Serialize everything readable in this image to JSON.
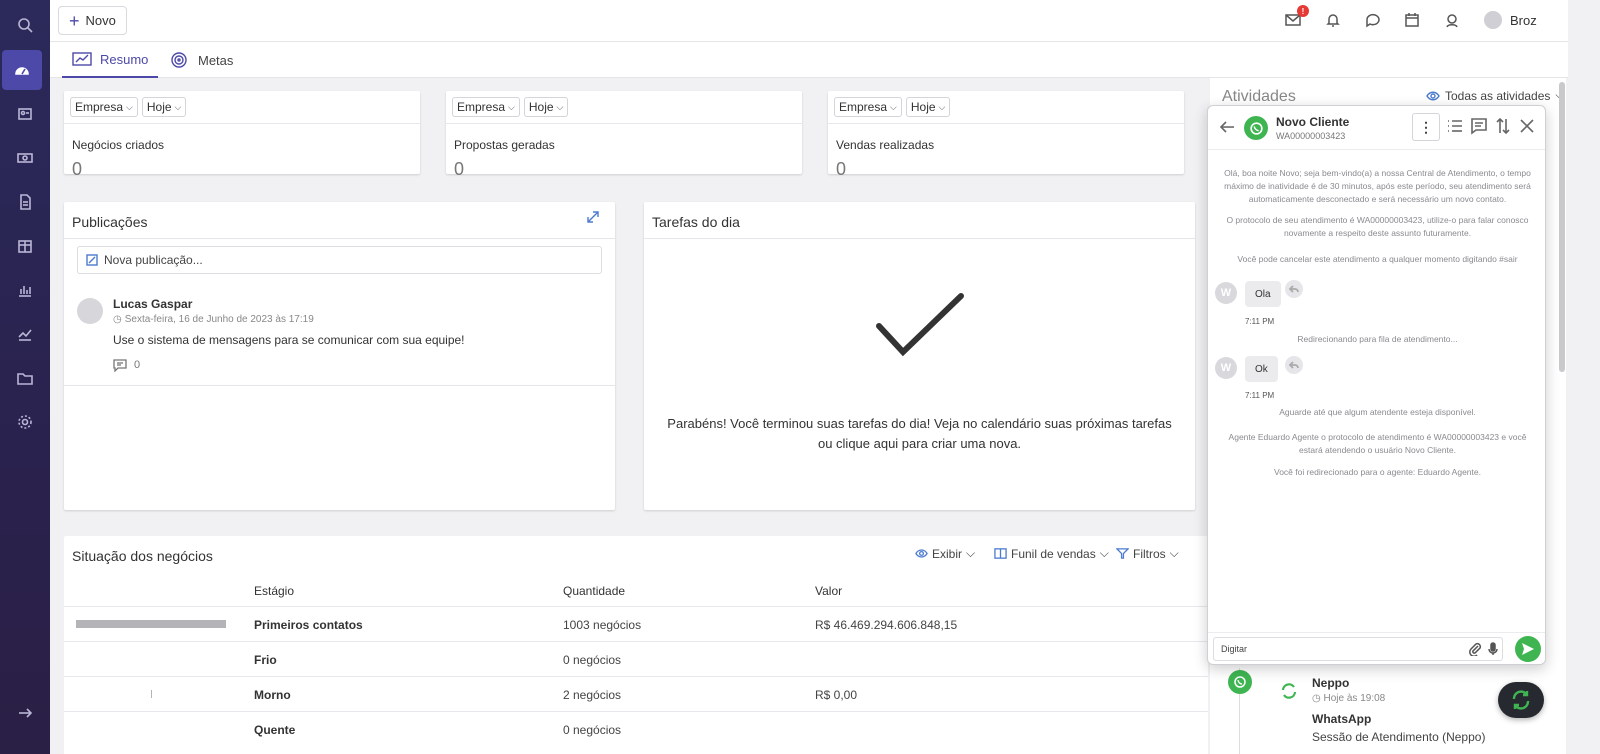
{
  "topbar": {
    "new_button": "Novo",
    "mail_badge": "!",
    "user_name": "Broz"
  },
  "tabs": [
    {
      "label": "Resumo",
      "active": true
    },
    {
      "label": "Metas",
      "active": false
    }
  ],
  "kpis": [
    {
      "filter_scope": "Empresa",
      "filter_period": "Hoje",
      "label": "Negócios criados",
      "value": "0"
    },
    {
      "filter_scope": "Empresa",
      "filter_period": "Hoje",
      "label": "Propostas geradas",
      "value": "0"
    },
    {
      "filter_scope": "Empresa",
      "filter_period": "Hoje",
      "label": "Vendas realizadas",
      "value": "0"
    }
  ],
  "publications": {
    "title": "Publicações",
    "placeholder": "Nova publicação...",
    "post": {
      "author": "Lucas Gaspar",
      "date": "Sexta-feira, 16 de Junho de 2023 às 17:19",
      "text": "Use o sistema de mensagens para se comunicar com sua equipe!",
      "comments": "0"
    }
  },
  "tasks": {
    "title": "Tarefas do dia",
    "message": "Parabéns! Você terminou suas tarefas do dia! Veja no calendário suas próximas tarefas ou clique aqui para criar uma nova."
  },
  "deals": {
    "title": "Situação dos negócios",
    "tools": {
      "show": "Exibir",
      "funnel": "Funil de vendas",
      "filters": "Filtros"
    },
    "headers": {
      "stage": "Estágio",
      "quantity": "Quantidade",
      "value": "Valor"
    },
    "rows": [
      {
        "stage": "Primeiros contatos",
        "quantity": "1003 negócios",
        "value": "R$ 46.469.294.606.848,15",
        "share": 1.0
      },
      {
        "stage": "Frio",
        "quantity": "0 negócios",
        "value": "",
        "share": 0
      },
      {
        "stage": "Morno",
        "quantity": "2 negócios",
        "value": "R$ 0,00",
        "share": 0.002
      },
      {
        "stage": "Quente",
        "quantity": "0 negócios",
        "value": "",
        "share": 0
      }
    ]
  },
  "activities": {
    "title": "Atividades",
    "filter": "Todas as atividades",
    "entry": {
      "title": "Neppo",
      "time": "Hoje às 19:08",
      "channel": "WhatsApp",
      "subtitle": "Sessão de Atendimento (Neppo)"
    }
  },
  "chat": {
    "contact_name": "Novo Cliente",
    "contact_id": "WA00000003423",
    "kebab": "⋮",
    "messages": {
      "welcome": "Olá, boa noite Novo; seja bem-vindo(a) a nossa Central de Atendimento, o tempo máximo de inatividade é de 30 minutos, após este período, seu atendimento será automaticamente desconectado e será necessário um novo contato.",
      "protocol": "O protocolo de seu atendimento é WA00000003423, utilize-o para falar conosco novamente a respeito deste assunto futuramente.",
      "cancel": "Você pode cancelar este atendimento a qualquer momento digitando #sair",
      "user_msg_1": "Ola",
      "time_1": "7:11 PM",
      "redirect": "Redirecionando para fila de atendimento...",
      "user_msg_2": "Ok",
      "time_2": "7:11 PM",
      "wait": "Aguarde até que algum atendente esteja disponível.",
      "agent": "Agente Eduardo Agente o protocolo de atendimento é WA00000003423 e você estará atendendo o usuário Novo Cliente.",
      "redirected": "Você foi redirecionado para o agente: Eduardo Agente."
    },
    "avatar_letter": "W",
    "input_placeholder": "Digitar"
  },
  "colors": {
    "accent": "#4c49a8",
    "whatsapp": "#3fb552",
    "sidebar": "#2b2a5a"
  }
}
